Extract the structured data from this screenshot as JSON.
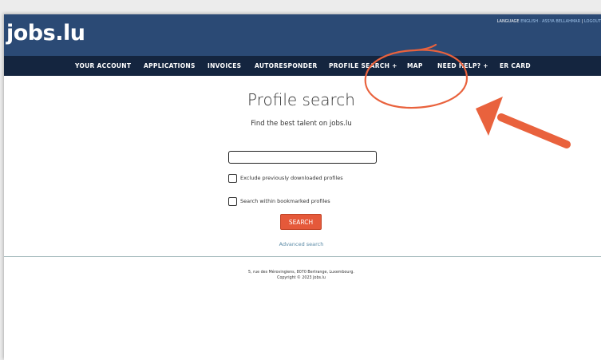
{
  "header": {
    "logo": "jobs.lu",
    "language_label": "LANGUAGE",
    "language_value": "ENGLISH",
    "sep1": "·",
    "user_name": "ASSYA BELLAHMAR",
    "sep2": "|",
    "logout": "LOGOUT"
  },
  "nav": {
    "items": [
      {
        "label": "YOUR ACCOUNT"
      },
      {
        "label": "APPLICATIONS"
      },
      {
        "label": "INVOICES"
      },
      {
        "label": "AUTORESPONDER"
      },
      {
        "label": "PROFILE SEARCH +"
      },
      {
        "label": "MAP"
      },
      {
        "label": "NEED HELP? +"
      },
      {
        "label": "ER CARD"
      }
    ]
  },
  "main": {
    "title": "Profile search",
    "subtitle": "Find the best talent on jobs.lu",
    "search_value": "",
    "exclude_label": "Exclude previously downloaded profiles",
    "bookmarked_label": "Search within bookmarked profiles",
    "search_button": "SEARCH",
    "advanced_link": "Advanced search"
  },
  "footer": {
    "address": "5, rue des Mérovingiens, 8070 Bertrange, Luxembourg.",
    "copyright": "Copyright © 2023 Jobs.lu"
  },
  "colors": {
    "header_bg": "#2b4a75",
    "nav_bg": "#14253f",
    "button": "#e5593a",
    "annotation": "#e9623d"
  },
  "icons": [
    "checkbox-icon",
    "annotation-arrow-icon",
    "annotation-circle-icon"
  ]
}
